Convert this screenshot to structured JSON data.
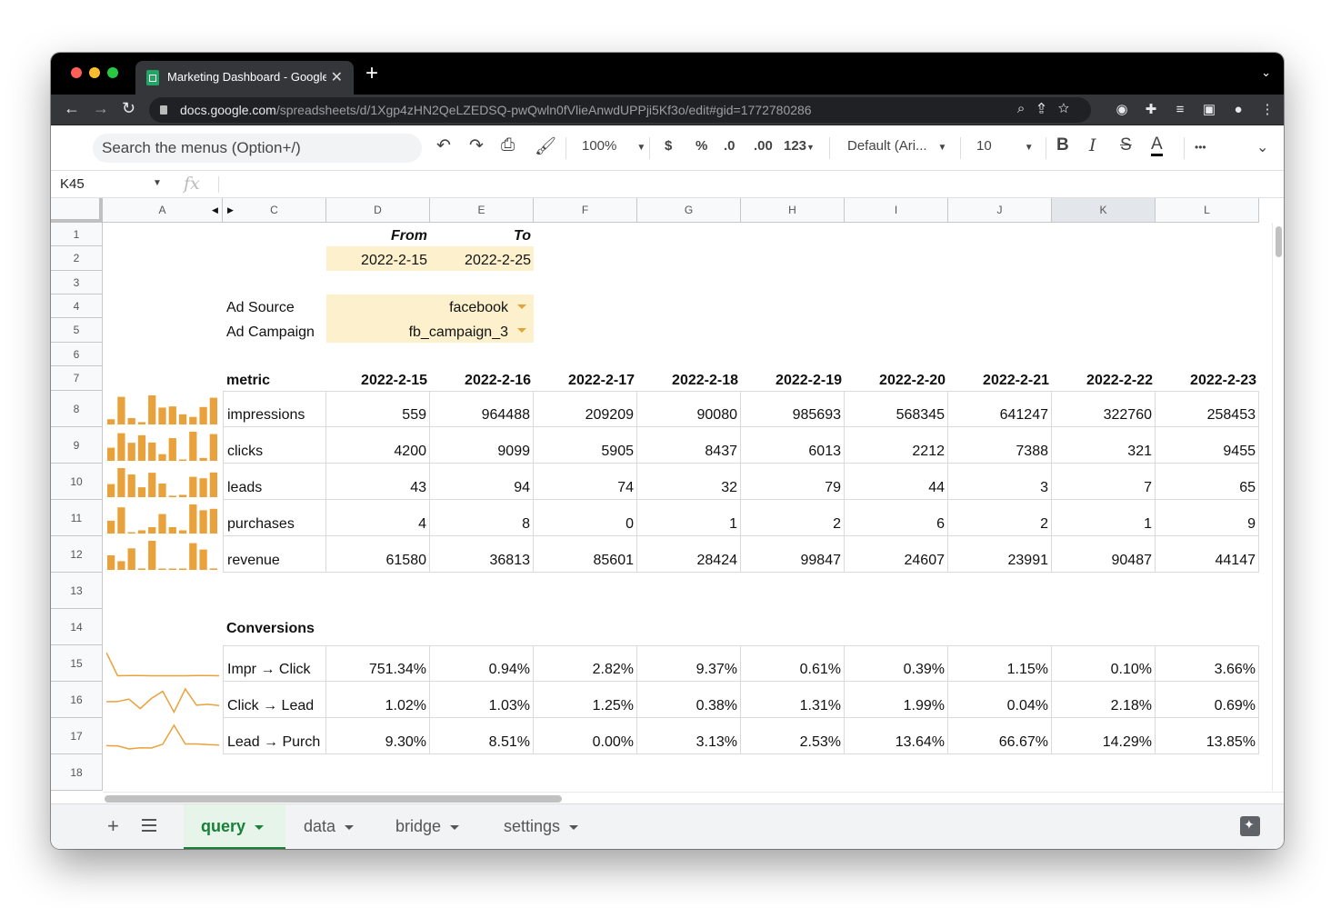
{
  "browser": {
    "tab_title": "Marketing Dashboard - Google Sheets",
    "url_host": "docs.google.com",
    "url_path": "/spreadsheets/d/1Xgp4zHN2QeLZEDSQ-pwQwln0fVlieAnwdUPPji5Kf3o/edit#gid=1772780286"
  },
  "toolbar": {
    "search_placeholder": "Search the menus (Option+/)",
    "zoom": "100%",
    "currency": "$",
    "percent": "%",
    "decrease_decimal": ".0",
    "increase_decimal": ".00",
    "number_format": "123",
    "font": "Default (Ari...",
    "font_size": "10",
    "bold": "B",
    "italic": "I",
    "strike": "S",
    "text_color": "A",
    "more": "•••"
  },
  "formula_bar": {
    "name_box": "K45",
    "fx": "fx"
  },
  "columns": [
    "A",
    "C",
    "D",
    "E",
    "F",
    "G",
    "H",
    "I",
    "J",
    "K",
    "L"
  ],
  "rows": [
    "1",
    "2",
    "3",
    "4",
    "5",
    "6",
    "7",
    "8",
    "9",
    "10",
    "11",
    "12",
    "13",
    "14",
    "15",
    "16",
    "17",
    "18"
  ],
  "date_range": {
    "from_label": "From",
    "to_label": "To",
    "from": "2022-2-15",
    "to": "2022-2-25"
  },
  "filters": {
    "source_label": "Ad Source",
    "source_value": "facebook",
    "campaign_label": "Ad Campaign",
    "campaign_value": "fb_campaign_3"
  },
  "metrics_table": {
    "header": "metric",
    "dates": [
      "2022-2-15",
      "2022-2-16",
      "2022-2-17",
      "2022-2-18",
      "2022-2-19",
      "2022-2-20",
      "2022-2-21",
      "2022-2-22",
      "2022-2-23"
    ],
    "rows": [
      {
        "name": "impressions",
        "values": [
          "559",
          "964488",
          "209209",
          "90080",
          "985693",
          "568345",
          "641247",
          "322760",
          "258453"
        ],
        "spark": [
          0.18,
          0.95,
          0.22,
          0.08,
          1.0,
          0.58,
          0.62,
          0.35,
          0.26,
          0.6,
          0.92
        ]
      },
      {
        "name": "clicks",
        "values": [
          "4200",
          "9099",
          "5905",
          "8437",
          "6013",
          "2212",
          "7388",
          "321",
          "9455"
        ],
        "spark": [
          0.45,
          0.95,
          0.62,
          0.88,
          0.63,
          0.23,
          0.78,
          0.04,
          1.0,
          0.1,
          0.92
        ]
      },
      {
        "name": "leads",
        "values": [
          "43",
          "94",
          "74",
          "32",
          "79",
          "44",
          "3",
          "7",
          "65"
        ],
        "spark": [
          0.45,
          1.0,
          0.78,
          0.34,
          0.84,
          0.47,
          0.05,
          0.08,
          0.7,
          0.65,
          0.85
        ]
      },
      {
        "name": "purchases",
        "values": [
          "4",
          "8",
          "0",
          "1",
          "2",
          "6",
          "2",
          "1",
          "9"
        ],
        "spark": [
          0.44,
          0.9,
          0.02,
          0.11,
          0.22,
          0.67,
          0.22,
          0.11,
          1.0,
          0.8,
          0.85
        ]
      },
      {
        "name": "revenue",
        "values": [
          "61580",
          "36813",
          "85601",
          "28424",
          "99847",
          "24607",
          "23991",
          "90487",
          "44147"
        ],
        "spark": [
          0.5,
          0.3,
          0.74,
          0.05,
          1.0,
          0.04,
          0.03,
          0.02,
          0.92,
          0.7,
          0.05
        ]
      }
    ]
  },
  "conversions_table": {
    "header": "Conversions",
    "rows": [
      {
        "name": "Impr → Click",
        "values": [
          "751.34%",
          "0.94%",
          "2.82%",
          "9.37%",
          "0.61%",
          "0.39%",
          "1.15%",
          "0.10%",
          "3.66%"
        ],
        "spark": [
          1.0,
          0.02,
          0.03,
          0.03,
          0.02,
          0.02,
          0.02,
          0.02,
          0.03,
          0.03,
          0.02
        ]
      },
      {
        "name": "Click → Lead",
        "values": [
          "1.02%",
          "1.03%",
          "1.25%",
          "0.38%",
          "1.31%",
          "1.99%",
          "0.04%",
          "2.18%",
          "0.69%"
        ],
        "spark": [
          0.46,
          0.47,
          0.57,
          0.17,
          0.6,
          0.9,
          0.02,
          1.0,
          0.31,
          0.35,
          0.3
        ]
      },
      {
        "name": "Lead → Purch",
        "values": [
          "9.30%",
          "8.51%",
          "0.00%",
          "3.13%",
          "2.53%",
          "13.64%",
          "66.67%",
          "14.29%",
          "13.85%"
        ],
        "spark": [
          0.14,
          0.13,
          0.0,
          0.05,
          0.04,
          0.2,
          1.0,
          0.21,
          0.21,
          0.18,
          0.16
        ]
      }
    ]
  },
  "sheets": [
    "query",
    "data",
    "bridge",
    "settings"
  ],
  "colors": {
    "spark": "#e9a23b",
    "highlight": "#fdf1cd",
    "active_tab": "#188038"
  }
}
